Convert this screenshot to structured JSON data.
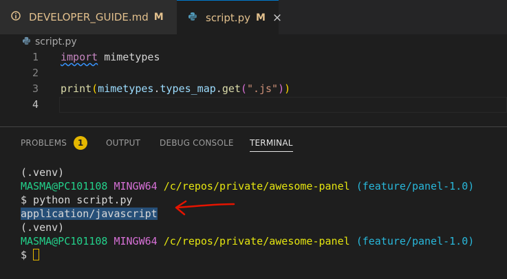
{
  "tabs": [
    {
      "label": "DEVELOPER_GUIDE.md",
      "modified": "M",
      "icon": "info-icon"
    },
    {
      "label": "script.py",
      "modified": "M",
      "icon": "python-icon",
      "close": "×"
    }
  ],
  "breadcrumb": {
    "file": "script.py",
    "icon": "python-icon"
  },
  "editor": {
    "line_numbers": [
      "1",
      "2",
      "3",
      "4"
    ],
    "line1": {
      "keyword": "import",
      "module": "mimetypes"
    },
    "line3": {
      "func": "print",
      "open": "(",
      "obj": "mimetypes",
      "dot1": ".",
      "attr": "types_map",
      "dot2": ".",
      "method": "get",
      "open2": "(",
      "str": "\".js\"",
      "close2": ")",
      "close": ")"
    }
  },
  "panel": {
    "tabs": {
      "problems": "PROBLEMS",
      "problems_count": "1",
      "output": "OUTPUT",
      "debug": "DEBUG CONSOLE",
      "terminal": "TERMINAL"
    }
  },
  "terminal": {
    "venv1": "(.venv)",
    "user1": "MASMA@PC101108",
    "sys1": "MINGW64",
    "path1": "/c/repos/private/awesome-panel",
    "branch1": "(feature/panel-1.0)",
    "cmd": "$ python script.py",
    "output": "application/javascript",
    "venv2": "(.venv)",
    "user2": "MASMA@PC101108",
    "sys2": "MINGW64",
    "path2": "/c/repos/private/awesome-panel",
    "branch2": "(feature/panel-1.0)",
    "prompt": "$"
  },
  "colors": {
    "accent": "#007acc",
    "annotation_arrow": "#e51400",
    "badge": "#e5b700"
  }
}
